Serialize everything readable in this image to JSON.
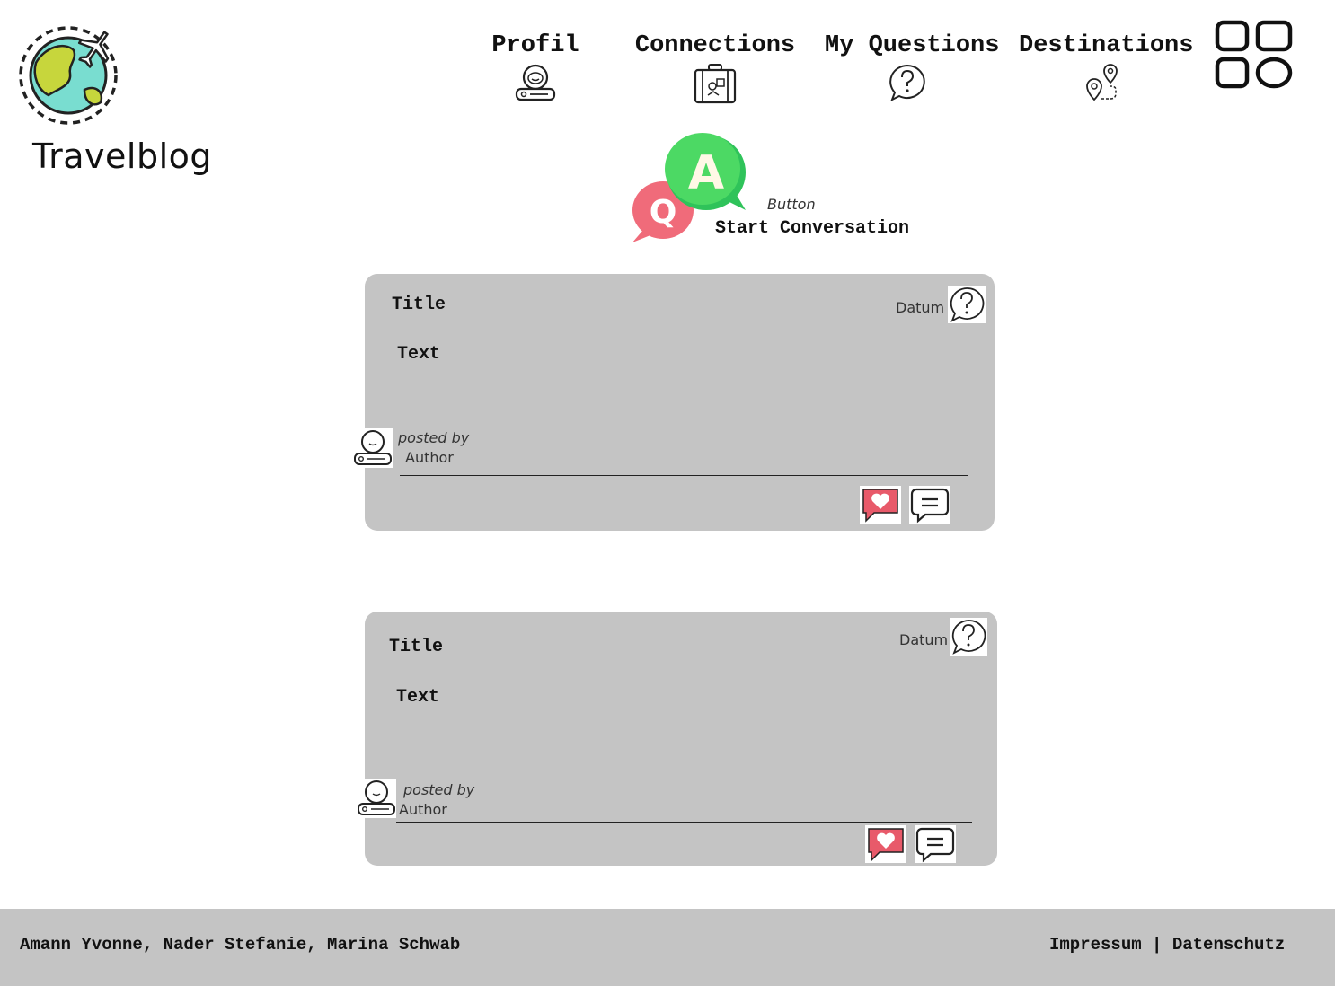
{
  "header": {
    "brand": "Travelblog",
    "nav": [
      {
        "label": "Profil",
        "icon": "profile-icon"
      },
      {
        "label": "Connections",
        "icon": "suitcase-icon"
      },
      {
        "label": "My Questions",
        "icon": "question-bubble-icon"
      },
      {
        "label": "Destinations",
        "icon": "location-pin-icon"
      }
    ],
    "menu_icon": "grid-menu-icon"
  },
  "start_conversation": {
    "small_label": "Button",
    "label": "Start Conversation",
    "icon": "qa-bubbles-icon"
  },
  "posts": [
    {
      "title": "Title",
      "text": "Text",
      "date": "Datum",
      "posted_by": "posted by",
      "author": "Author"
    },
    {
      "title": "Title",
      "text": "Text",
      "date": "Datum",
      "posted_by": "posted by",
      "author": "Author"
    }
  ],
  "footer": {
    "authors": "Amann Yvonne, Nader Stefanie, Marina Schwab",
    "impressum": "Impressum",
    "separator": "|",
    "datenschutz": "Datenschutz"
  },
  "colors": {
    "card_bg": "#c4c4c4",
    "footer_bg": "#c4c4c4",
    "like_red": "#e85a6a",
    "qa_green": "#4cd964",
    "qa_red": "#f06b7a"
  }
}
